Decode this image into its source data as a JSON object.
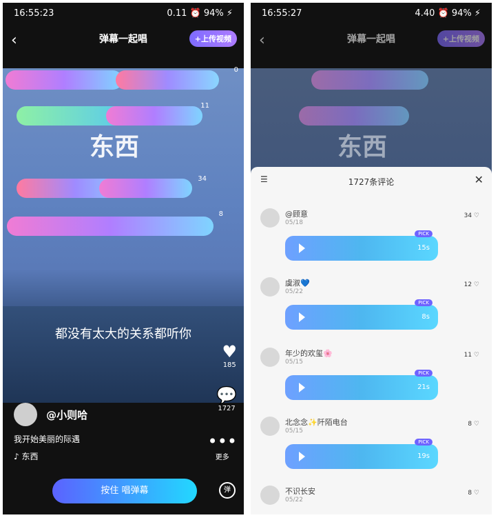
{
  "left": {
    "time": "16:55:23",
    "status_mid": "0.11",
    "battery": "94%",
    "title": "弹幕一起唱",
    "upload": "+上传视频",
    "song": "东西",
    "lyric": "都没有太大的关系都听你",
    "user": "@小则哈",
    "desc": "我开始美丽的际遇",
    "music": "东西",
    "likes": "185",
    "comments": "1727",
    "more": "更多",
    "button": "按住 唱弹幕",
    "counts": [
      "0",
      "11",
      "34",
      "8"
    ]
  },
  "right": {
    "time": "16:55:27",
    "status_mid": "4.40",
    "battery": "94%",
    "title": "弹幕一起唱",
    "upload": "+上传视频",
    "song": "东西",
    "sheet_title": "1727条评论",
    "comments": [
      {
        "name": "@顾意",
        "date": "05/18",
        "likes": "34",
        "duration": "15s",
        "pick": "PICK"
      },
      {
        "name": "虞淑💙",
        "date": "05/22",
        "likes": "12",
        "duration": "8s",
        "pick": "PICK"
      },
      {
        "name": "年少的欢玺🌸",
        "date": "05/15",
        "likes": "11",
        "duration": "21s",
        "pick": "PICK"
      },
      {
        "name": "北念念✨阡陌电台",
        "date": "05/15",
        "likes": "8",
        "duration": "19s",
        "pick": "PICK"
      },
      {
        "name": "不识长安",
        "date": "05/22",
        "likes": "8"
      }
    ]
  }
}
